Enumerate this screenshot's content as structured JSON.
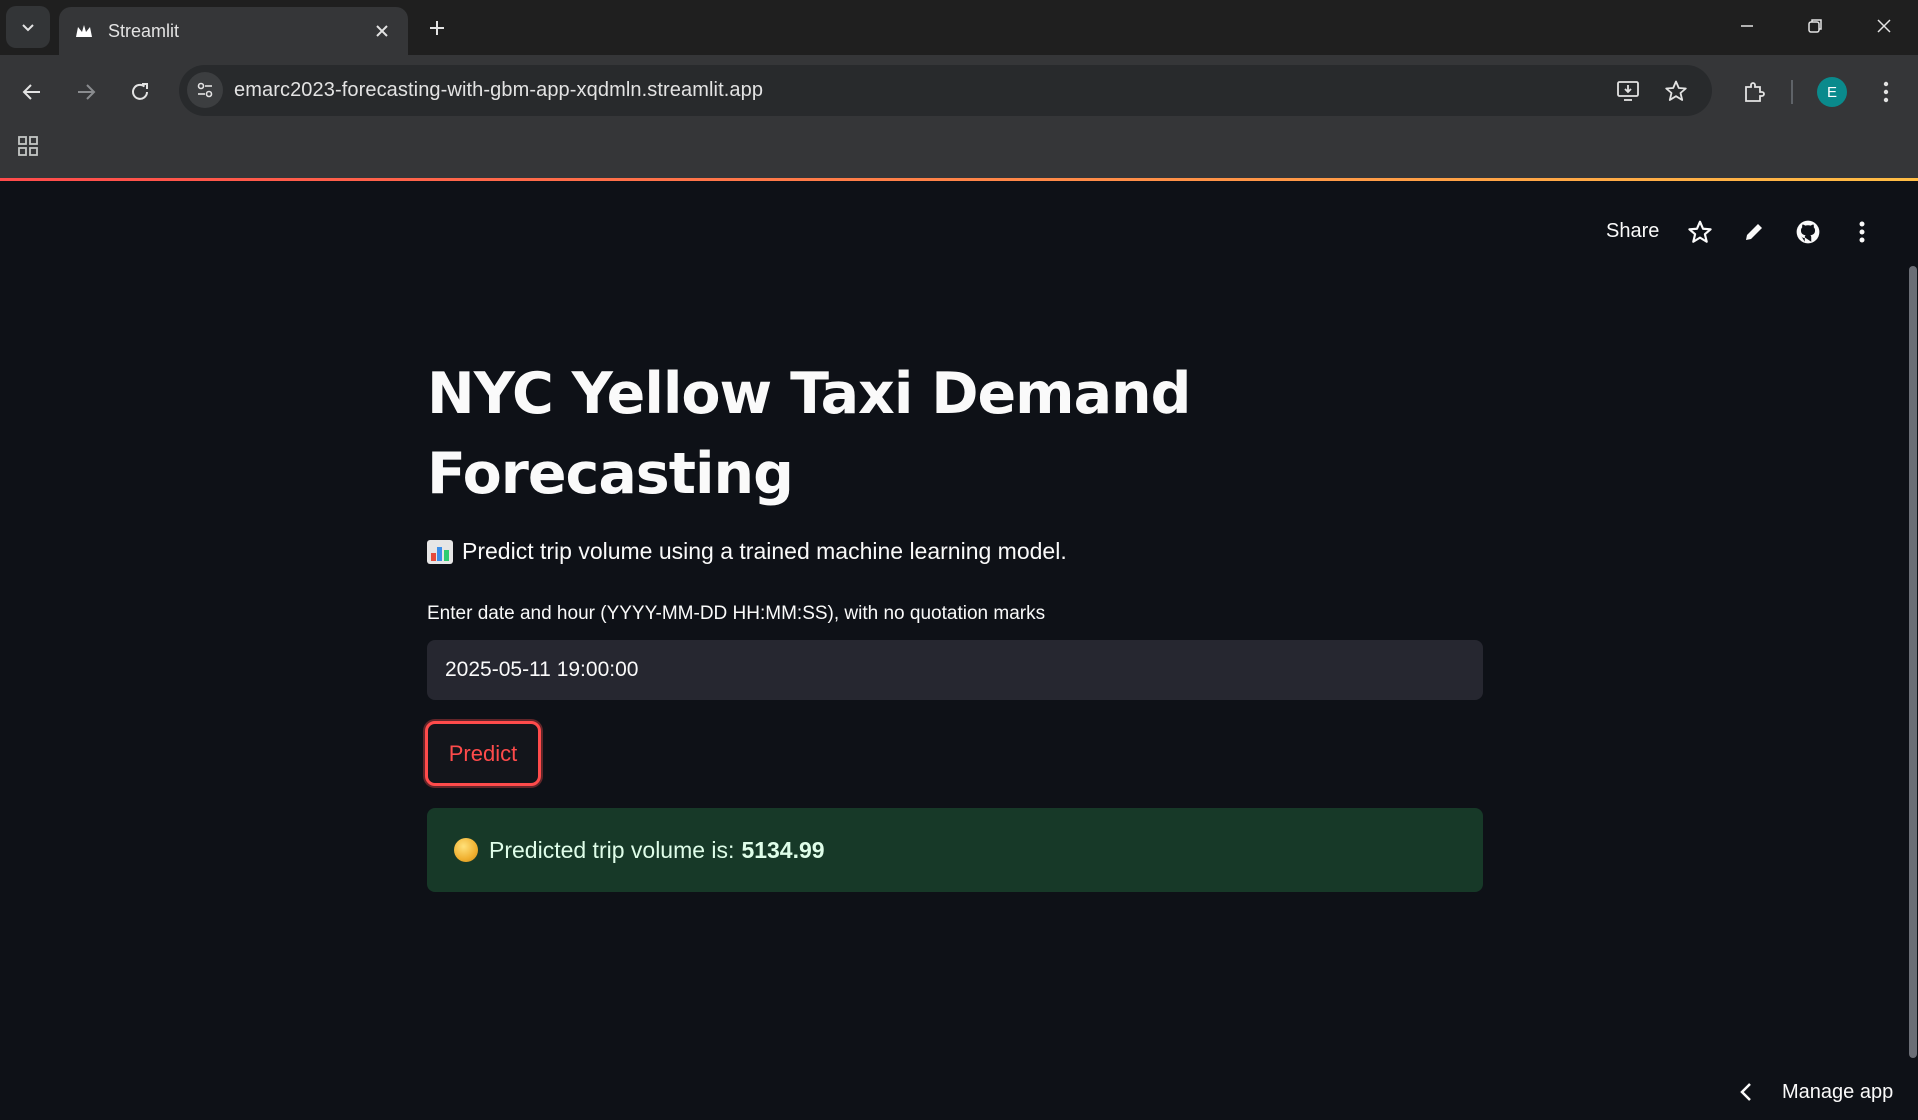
{
  "browser": {
    "tab_title": "Streamlit",
    "url": "emarc2023-forecasting-with-gbm-app-xqdmln.streamlit.app",
    "profile_initial": "E"
  },
  "header": {
    "share_label": "Share"
  },
  "main": {
    "title": "NYC Yellow Taxi Demand Forecasting",
    "subtitle": "Predict trip volume using a trained machine learning model.",
    "input_label": "Enter date and hour (YYYY-MM-DD HH:MM:SS), with no quotation marks",
    "input_value": "2025-05-11 19:00:00",
    "predict_label": "Predict",
    "result_prefix": "Predicted trip volume is:",
    "result_value": "5134.99"
  },
  "footer": {
    "manage_app_label": "Manage app"
  },
  "colors": {
    "accent": "#ff4b4b",
    "background": "#0e1117",
    "success_bg": "#173928"
  }
}
